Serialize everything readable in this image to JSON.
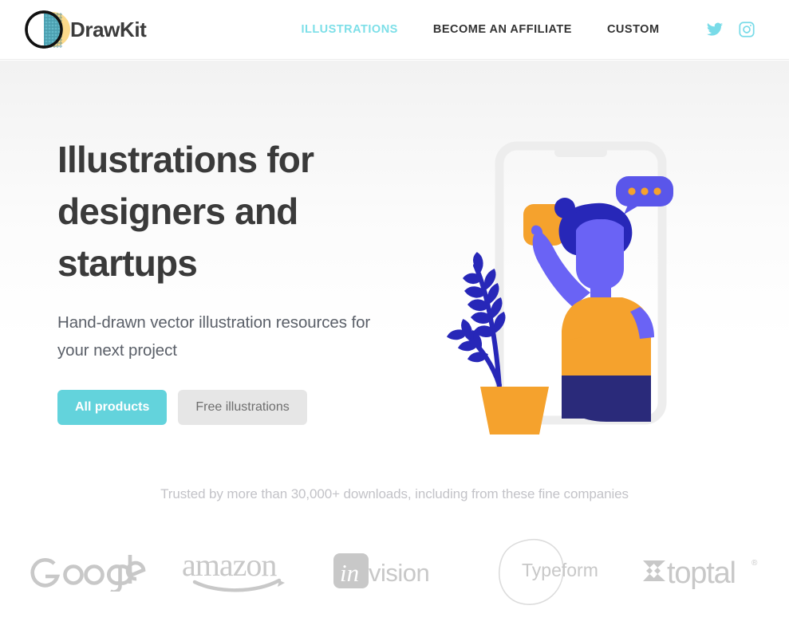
{
  "header": {
    "brand_name": "DrawKit",
    "logo_icon": "drawkit-circle-logo",
    "nav": [
      {
        "label": "ILLUSTRATIONS",
        "active": true
      },
      {
        "label": "BECOME AN AFFILIATE",
        "active": false
      },
      {
        "label": "CUSTOM",
        "active": false
      }
    ],
    "social": [
      {
        "name": "twitter-icon",
        "label": "Twitter"
      },
      {
        "name": "instagram-icon",
        "label": "Instagram"
      }
    ]
  },
  "hero": {
    "title": "Illustrations for designers and startups",
    "subtitle": "Hand-drawn vector illustration resources for your next project",
    "primary_button": "All products",
    "secondary_button": "Free illustrations",
    "illustration_name": "person-pointing-at-phone-illustration"
  },
  "trust": {
    "caption": "Trusted by more than 30,000+ downloads, including from these fine companies",
    "logos": [
      {
        "name": "google-logo",
        "label": "Google"
      },
      {
        "name": "amazon-logo",
        "label": "amazon"
      },
      {
        "name": "invision-logo",
        "label": "invision"
      },
      {
        "name": "typeform-logo",
        "label": "Typeform"
      },
      {
        "name": "toptal-logo",
        "label": "toptal"
      }
    ]
  },
  "colors": {
    "accent_cyan": "#63d3dc",
    "nav_active": "#7ddfe8",
    "text_dark": "#3a3a3a",
    "text_muted": "#5b6069",
    "caption_gray": "#c3c3c8",
    "logo_gray": "#c8c8c8",
    "illustration_orange": "#f5a22d",
    "illustration_deep_blue": "#2727b8",
    "illustration_periwinkle": "#6a63f5",
    "button_secondary_bg": "#e6e6e6"
  }
}
